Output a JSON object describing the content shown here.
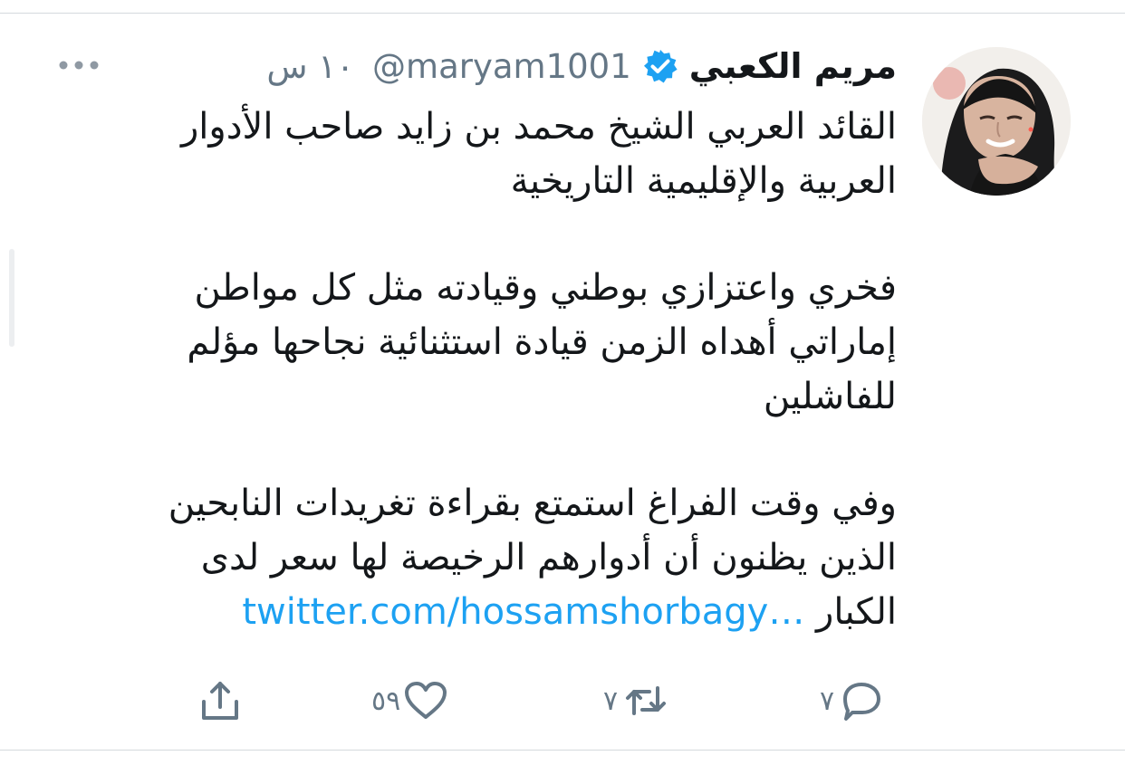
{
  "tweet": {
    "author": {
      "name": "مريم الكعبي",
      "handle": "@maryam1001",
      "verified": true
    },
    "time": "١٠ س",
    "text": {
      "paragraph_1": [
        "القائد العربي الشيخ محمد بن زايد صاحب الأدوار",
        "العربية والإقليمية التاريخية"
      ],
      "paragraph_2": [
        "فخري واعتزازي بوطني وقيادته مثل كل مواطن",
        "إماراتي أهداه الزمن قيادة استثنائية نجاحها مؤلم",
        "للفاشلين"
      ],
      "paragraph_3": [
        "وفي وقت الفراغ استمتع بقراءة تغريدات النابحين",
        "الذين يظنون أن أدوارهم الرخيصة لها سعر لدى",
        "الكبار"
      ],
      "link": "twitter.com/hossamshorbagy…"
    },
    "actions": {
      "reply_count": "٧",
      "retweet_count": "٧",
      "like_count": "٥٩"
    }
  },
  "icons": {
    "more": "more-dots-icon",
    "verified": "verified-badge-icon",
    "reply": "reply-bubble-icon",
    "retweet": "retweet-icon",
    "like": "heart-icon",
    "share": "share-icon"
  },
  "colors": {
    "link": "#1da1f2",
    "secondary_text": "#657786",
    "primary_text": "#14171a",
    "verified": "#1da1f2"
  }
}
